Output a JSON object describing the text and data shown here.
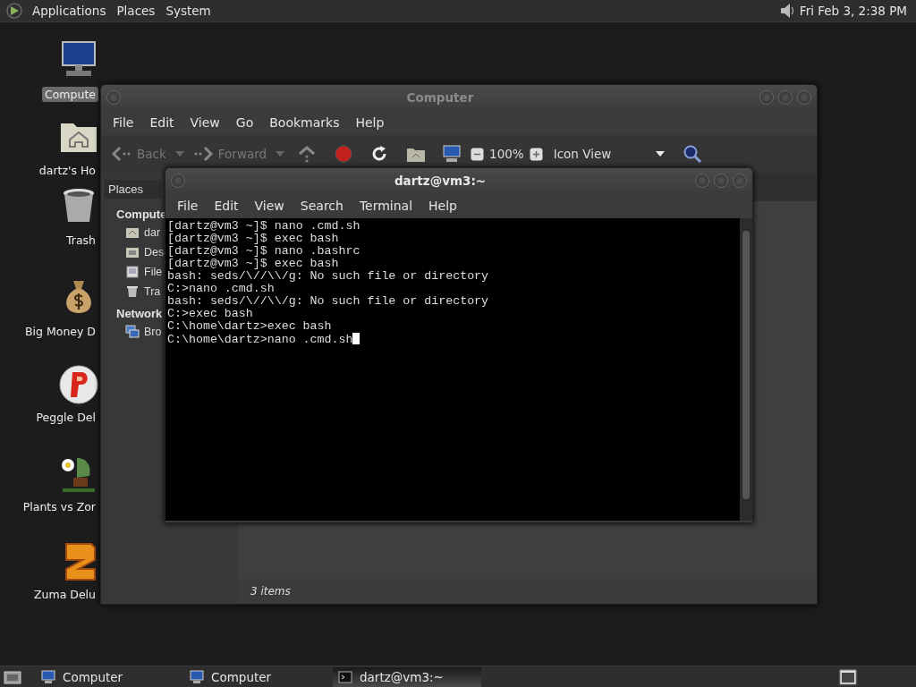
{
  "top_panel": {
    "menus": [
      "Applications",
      "Places",
      "System"
    ],
    "clock": "Fri Feb 3, 2:38 PM"
  },
  "desktop_icons": [
    {
      "label": "Compute",
      "kind": "computer",
      "selected": true
    },
    {
      "label": "dartz's Ho",
      "kind": "home",
      "selected": false
    },
    {
      "label": "Trash",
      "kind": "trash",
      "selected": false
    },
    {
      "label": "Big Money D",
      "kind": "moneybag",
      "selected": false
    },
    {
      "label": "Peggle Del",
      "kind": "ball",
      "selected": false
    },
    {
      "label": "Plants vs Zor",
      "kind": "plant",
      "selected": false
    },
    {
      "label": "Zuma Delu",
      "kind": "block",
      "selected": false
    }
  ],
  "file_manager": {
    "title": "Computer",
    "menus": [
      "File",
      "Edit",
      "View",
      "Go",
      "Bookmarks",
      "Help"
    ],
    "toolbar": {
      "back": {
        "label": "Back",
        "disabled": true
      },
      "forward": {
        "label": "Forward",
        "disabled": true
      },
      "zoom": "100%",
      "view": "Icon View"
    },
    "sidebar": {
      "header": "Places",
      "sections": [
        {
          "title": "Compute",
          "items": [
            {
              "label": "dar",
              "kind": "home"
            },
            {
              "label": "Des",
              "kind": "desktop"
            },
            {
              "label": "File",
              "kind": "drive"
            },
            {
              "label": "Tra",
              "kind": "trash"
            }
          ]
        },
        {
          "title": "Network",
          "items": [
            {
              "label": "Bro",
              "kind": "network"
            }
          ]
        }
      ]
    },
    "status": "3 items"
  },
  "terminal": {
    "title": "dartz@vm3:~",
    "menus": [
      "File",
      "Edit",
      "View",
      "Search",
      "Terminal",
      "Help"
    ],
    "lines": [
      "[dartz@vm3 ~]$ nano .cmd.sh",
      "[dartz@vm3 ~]$ exec bash",
      "[dartz@vm3 ~]$ nano .bashrc",
      "[dartz@vm3 ~]$ exec bash",
      "bash: seds/\\//\\\\/g: No such file or directory",
      "C:>nano .cmd.sh",
      "bash: seds/\\//\\\\/g: No such file or directory",
      "C:>exec bash",
      "C:\\home\\dartz>exec bash",
      "C:\\home\\dartz>nano .cmd.sh"
    ]
  },
  "taskbar": {
    "tasks": [
      {
        "label": "Computer",
        "kind": "computer",
        "selected": false
      },
      {
        "label": "Computer",
        "kind": "computer",
        "selected": false
      },
      {
        "label": "dartz@vm3:~",
        "kind": "terminal",
        "selected": true
      }
    ]
  }
}
